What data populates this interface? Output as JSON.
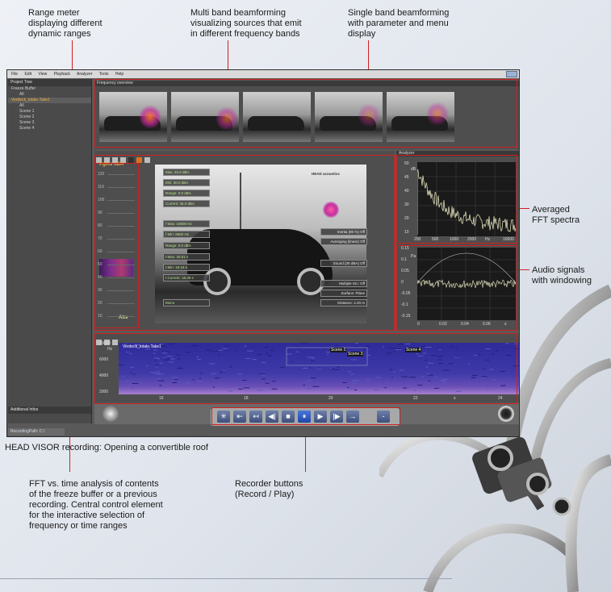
{
  "callouts": {
    "range_meter": [
      "Range meter",
      "displaying different",
      "dynamic ranges"
    ],
    "multiband": [
      "Multi band beamforming",
      "visualizing sources that emit",
      "in different frequency bands"
    ],
    "singleband": [
      "Single band beamforming",
      "with parameter and menu",
      "display"
    ],
    "fft_spectra": [
      "Averaged",
      "FFT spectra"
    ],
    "audio_signals": [
      "Audio signals",
      "with windowing"
    ],
    "fft_vs_time": [
      "FFT vs. time analysis of contents",
      "of the freeze buffer or a previous",
      "recording. Central control element",
      "for the interactive selection of",
      "frequency or time ranges"
    ],
    "recorder": [
      "Recorder buttons",
      "(Record / Play)"
    ]
  },
  "caption": "HEAD VISOR recording: Opening a convertible roof",
  "app": {
    "menu": [
      "File",
      "Edit",
      "View",
      "Playback",
      "Analyzer",
      "Tools",
      "Help"
    ],
    "project_tree": {
      "title": "Project Tree",
      "items": [
        {
          "label": "Freeze Buffer",
          "level": 0
        },
        {
          "label": "All",
          "level": 1
        },
        {
          "label": "Verdeck_totale.Take1",
          "level": 0,
          "selected": true
        },
        {
          "label": "All",
          "level": 1
        },
        {
          "label": "Scene 1",
          "level": 1
        },
        {
          "label": "Scene 2",
          "level": 1
        },
        {
          "label": "Scene 3",
          "level": 1
        },
        {
          "label": "Scene 4",
          "level": 1
        }
      ],
      "additional": "Additional Infos",
      "rec_path": "RecordingPath: C:\\"
    },
    "frequency_overview": {
      "title": "Frequency overview"
    },
    "meter": {
      "title": "Pgms dBA",
      "ticks": [
        "120",
        "110",
        "100",
        "90",
        "80",
        "70",
        "60",
        "50",
        "40",
        "30",
        "20",
        "10"
      ],
      "abs": "Abs"
    },
    "beamform": {
      "brand": "HEAD acoustics",
      "left_tags": [
        "Max: 45.0 dBA",
        "Min: 30.0 dBA",
        "Range: 0.0 dBA",
        "Current: 45.0 dBA",
        "f Max: 10000 Hz",
        "f Min: 6660 Hz",
        "Range: 0.0 dBA",
        "t Max: 20.51 s",
        "t Min: 18.16 s",
        "t Current: 18.39 s",
        "Mono"
      ],
      "right_tags": [
        "Inertia (80 %) Off",
        "Averaging (linear) Off",
        "Sound (30 dBA) Off",
        "Multiple Src: Off",
        "Surface: Plane",
        "Distance: 4.20 m"
      ]
    },
    "analyzer": {
      "title": "Analyzer",
      "fft": {
        "ylabel": "dB",
        "yticks": [
          "50",
          "45",
          "40",
          "30",
          "20",
          "10"
        ],
        "xticks": [
          "200",
          "500",
          "1000",
          "2000",
          "Hz",
          "10000"
        ],
        "unit": "Hz"
      },
      "audio": {
        "ylabel": "Pa",
        "yticks": [
          "0.15",
          "0.1",
          "0.05",
          "0",
          "-0.05",
          "-0.1",
          "-0.15"
        ],
        "xticks": [
          "0",
          "0.02",
          "0.04",
          "0.06",
          "s"
        ]
      }
    },
    "spectrogram": {
      "title": "Verdeck_totale.Take1",
      "yunit": "Hz",
      "yticks": [
        "10000",
        "6000",
        "4000",
        "2000"
      ],
      "xticks": [
        "16",
        "18",
        "20",
        "22",
        "s",
        "24"
      ],
      "scenes": [
        "Scene 2",
        "Scene 3",
        "Scene 4"
      ]
    },
    "transport": [
      "✳",
      "⇤",
      "↤",
      "◀|",
      "■",
      "⏸",
      "▶",
      "|▶",
      "→",
      "‑"
    ]
  },
  "colors": {
    "accent": "#d02020",
    "highlight": "#f0b040",
    "spectro": "#1e2a8a"
  }
}
